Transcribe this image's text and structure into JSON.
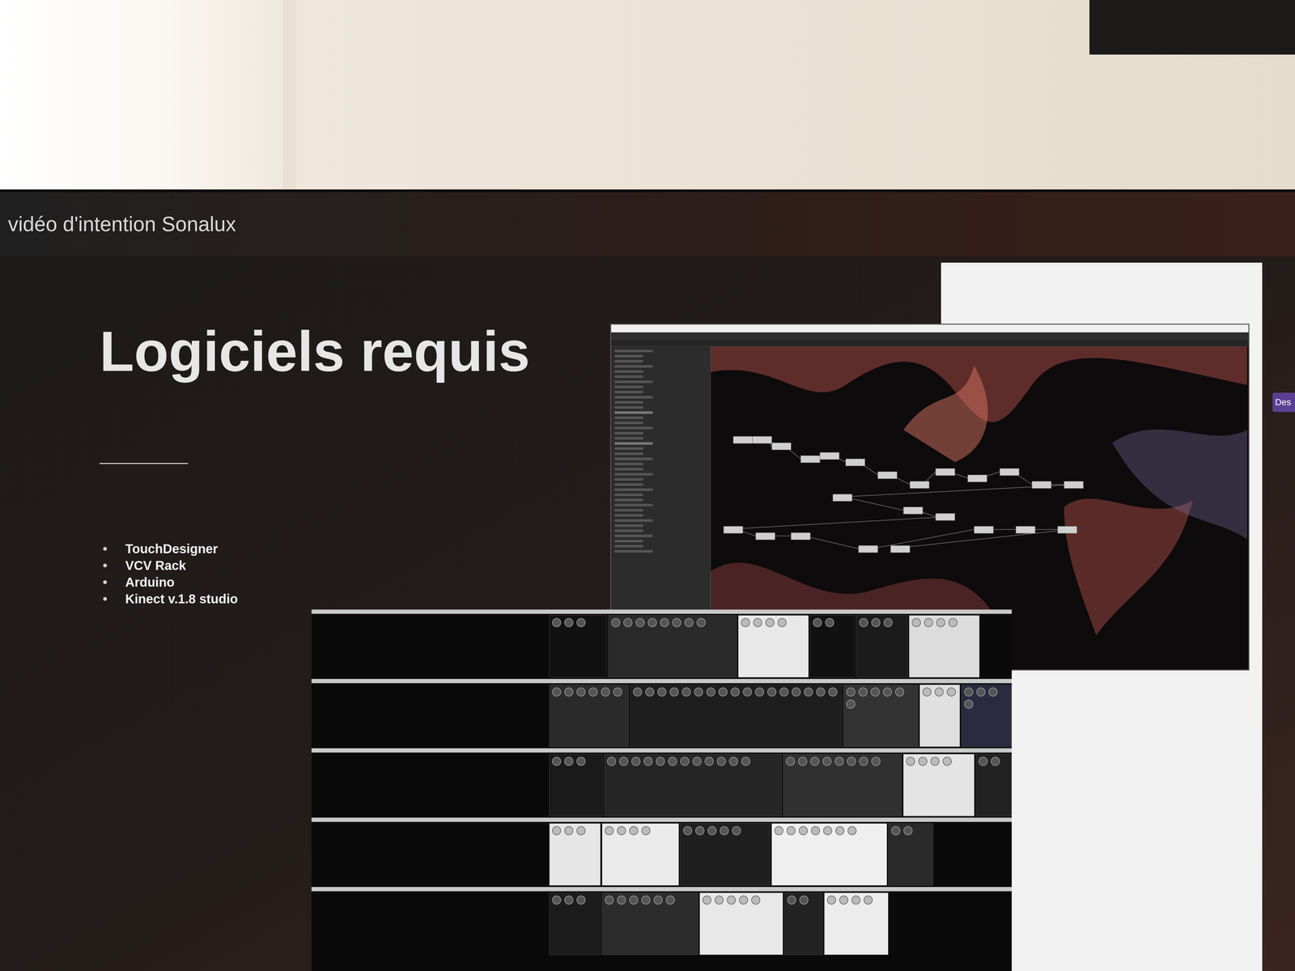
{
  "window": {
    "title": "vidéo d'intention Sonalux"
  },
  "slide": {
    "title": "Logiciels requis",
    "bullets": [
      {
        "marker": "•",
        "label": "TouchDesigner"
      },
      {
        "marker": "•",
        "label": "VCV Rack"
      },
      {
        "marker": "•",
        "label": "Arduino"
      },
      {
        "marker": "•",
        "label": "Kinect v.1.8 studio"
      }
    ]
  },
  "side_button": {
    "label": "Des"
  }
}
